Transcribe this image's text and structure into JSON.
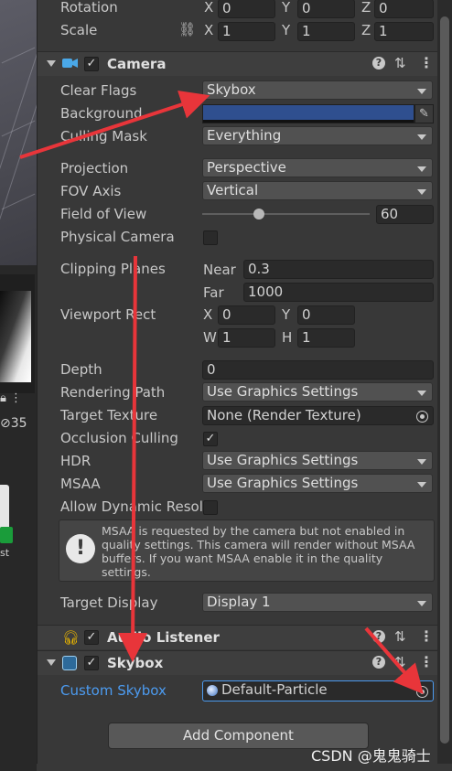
{
  "left_strip": {
    "icon_value_text": "35"
  },
  "transform": {
    "rotation": {
      "label": "Rotation",
      "x_axis": "X",
      "y_axis": "Y",
      "z_axis": "Z",
      "x": "0",
      "y": "0",
      "z": "0"
    },
    "scale": {
      "label": "Scale",
      "x_axis": "X",
      "y_axis": "Y",
      "z_axis": "Z",
      "x": "1",
      "y": "1",
      "z": "1"
    }
  },
  "camera": {
    "title": "Camera",
    "clear_flags": {
      "label": "Clear Flags",
      "value": "Skybox"
    },
    "background": {
      "label": "Background",
      "color": "#2f4f8f"
    },
    "culling_mask": {
      "label": "Culling Mask",
      "value": "Everything"
    },
    "projection": {
      "label": "Projection",
      "value": "Perspective"
    },
    "fov_axis": {
      "label": "FOV Axis",
      "value": "Vertical"
    },
    "field_of_view": {
      "label": "Field of View",
      "value": "60",
      "slider_fraction": 0.34
    },
    "physical_camera": {
      "label": "Physical Camera",
      "checked": false
    },
    "clipping_planes": {
      "label": "Clipping Planes",
      "near_label": "Near",
      "near": "0.3",
      "far_label": "Far",
      "far": "1000"
    },
    "viewport_rect": {
      "label": "Viewport Rect",
      "x_axis": "X",
      "y_axis": "Y",
      "w_axis": "W",
      "h_axis": "H",
      "x": "0",
      "y": "0",
      "w": "1",
      "h": "1"
    },
    "depth": {
      "label": "Depth",
      "value": "0"
    },
    "rendering_path": {
      "label": "Rendering Path",
      "value": "Use Graphics Settings"
    },
    "target_texture": {
      "label": "Target Texture",
      "value": "None (Render Texture)"
    },
    "occlusion_culling": {
      "label": "Occlusion Culling",
      "checked": true
    },
    "hdr": {
      "label": "HDR",
      "value": "Use Graphics Settings"
    },
    "msaa": {
      "label": "MSAA",
      "value": "Use Graphics Settings"
    },
    "allow_dynamic_resolution": {
      "label": "Allow Dynamic Resol",
      "checked": false
    },
    "help_message": "MSAA is requested by the camera but not enabled in quality settings. This camera will render without MSAA buffers. If you want MSAA enable it in the quality settings.",
    "target_display": {
      "label": "Target Display",
      "value": "Display 1"
    }
  },
  "audio_listener": {
    "title": "Audio Listener"
  },
  "skybox": {
    "title": "Skybox",
    "custom_skybox": {
      "label": "Custom Skybox",
      "value": "Default-Particle"
    }
  },
  "add_component_label": "Add Component",
  "watermark": "CSDN @鬼鬼骑士",
  "colors": {
    "annotation_arrow": "#e8353a",
    "link_label": "#4c9bf0"
  }
}
